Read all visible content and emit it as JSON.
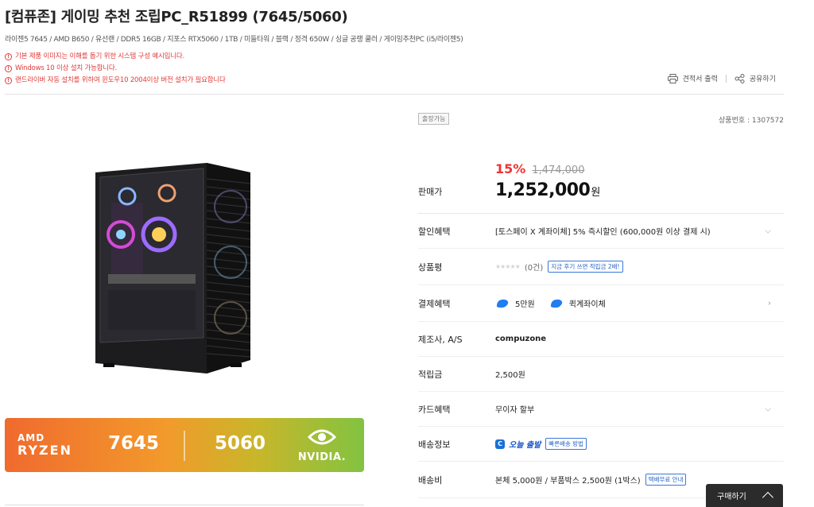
{
  "product": {
    "title": "[컴퓨존] 게이밍 추천 조립PC_R51899 (7645/5060)",
    "specs": "라이젠5 7645 / AMD B650 / 유선랜 / DDR5 16GB / 지포스 RTX5060 / 1TB / 미들타워 / 블랙 / 정격 650W / 싱글 공랭 쿨러 / 게이밍추천PC (i5/라이젠5)",
    "notices": [
      "기본 제품 이미지는 이해를 돕기 위한 시스템 구성 예시입니다.",
      "Windows 10 이상 설치 가능합니다.",
      "랜드라이버 자동 설치를 위하여 윈도우10 2004이상 버전 설치가 필요합니다"
    ]
  },
  "tools": {
    "print_label": "견적서 출력",
    "share_label": "공유하기"
  },
  "banner": {
    "amd_line1": "AMD",
    "amd_line2": "RYZEN",
    "cpu": "7645",
    "gpu": "5060",
    "nvidia": "NVIDIA."
  },
  "info": {
    "stock_badge": "출장가능",
    "product_no": "상품번호 : 1307572",
    "discount_pct": "15%",
    "original_price": "1,474,000",
    "price_label": "판매가",
    "price": "1,252,000",
    "price_unit": "원"
  },
  "rows": {
    "discount": {
      "label": "할인혜택",
      "value": "[토스페이 X 계좌이체] 5% 즉시할인 (600,000원 이상 결제 시)"
    },
    "review": {
      "label": "상품평",
      "stars": "★★★★★",
      "count": "(0건)",
      "chip": "지금 후기 쓰면 적립금 2배!"
    },
    "payment": {
      "label": "결제혜택",
      "opt1": "5만원",
      "opt2": "퀵계좌이체"
    },
    "maker": {
      "label": "제조사, A/S",
      "value": "compuzone"
    },
    "points": {
      "label": "적립금",
      "value": "2,500원"
    },
    "card": {
      "label": "카드혜택",
      "value": "무이자 할부"
    },
    "shipping": {
      "label": "배송정보",
      "today": "오늘 출발",
      "chip": "빠른배송 방법"
    },
    "fee": {
      "label": "배송비",
      "value": "본체 5,000원 / 부품박스 2,500원 (1박스)",
      "chip": "택배무료 안내"
    }
  },
  "buy": {
    "label": "구매하기"
  }
}
